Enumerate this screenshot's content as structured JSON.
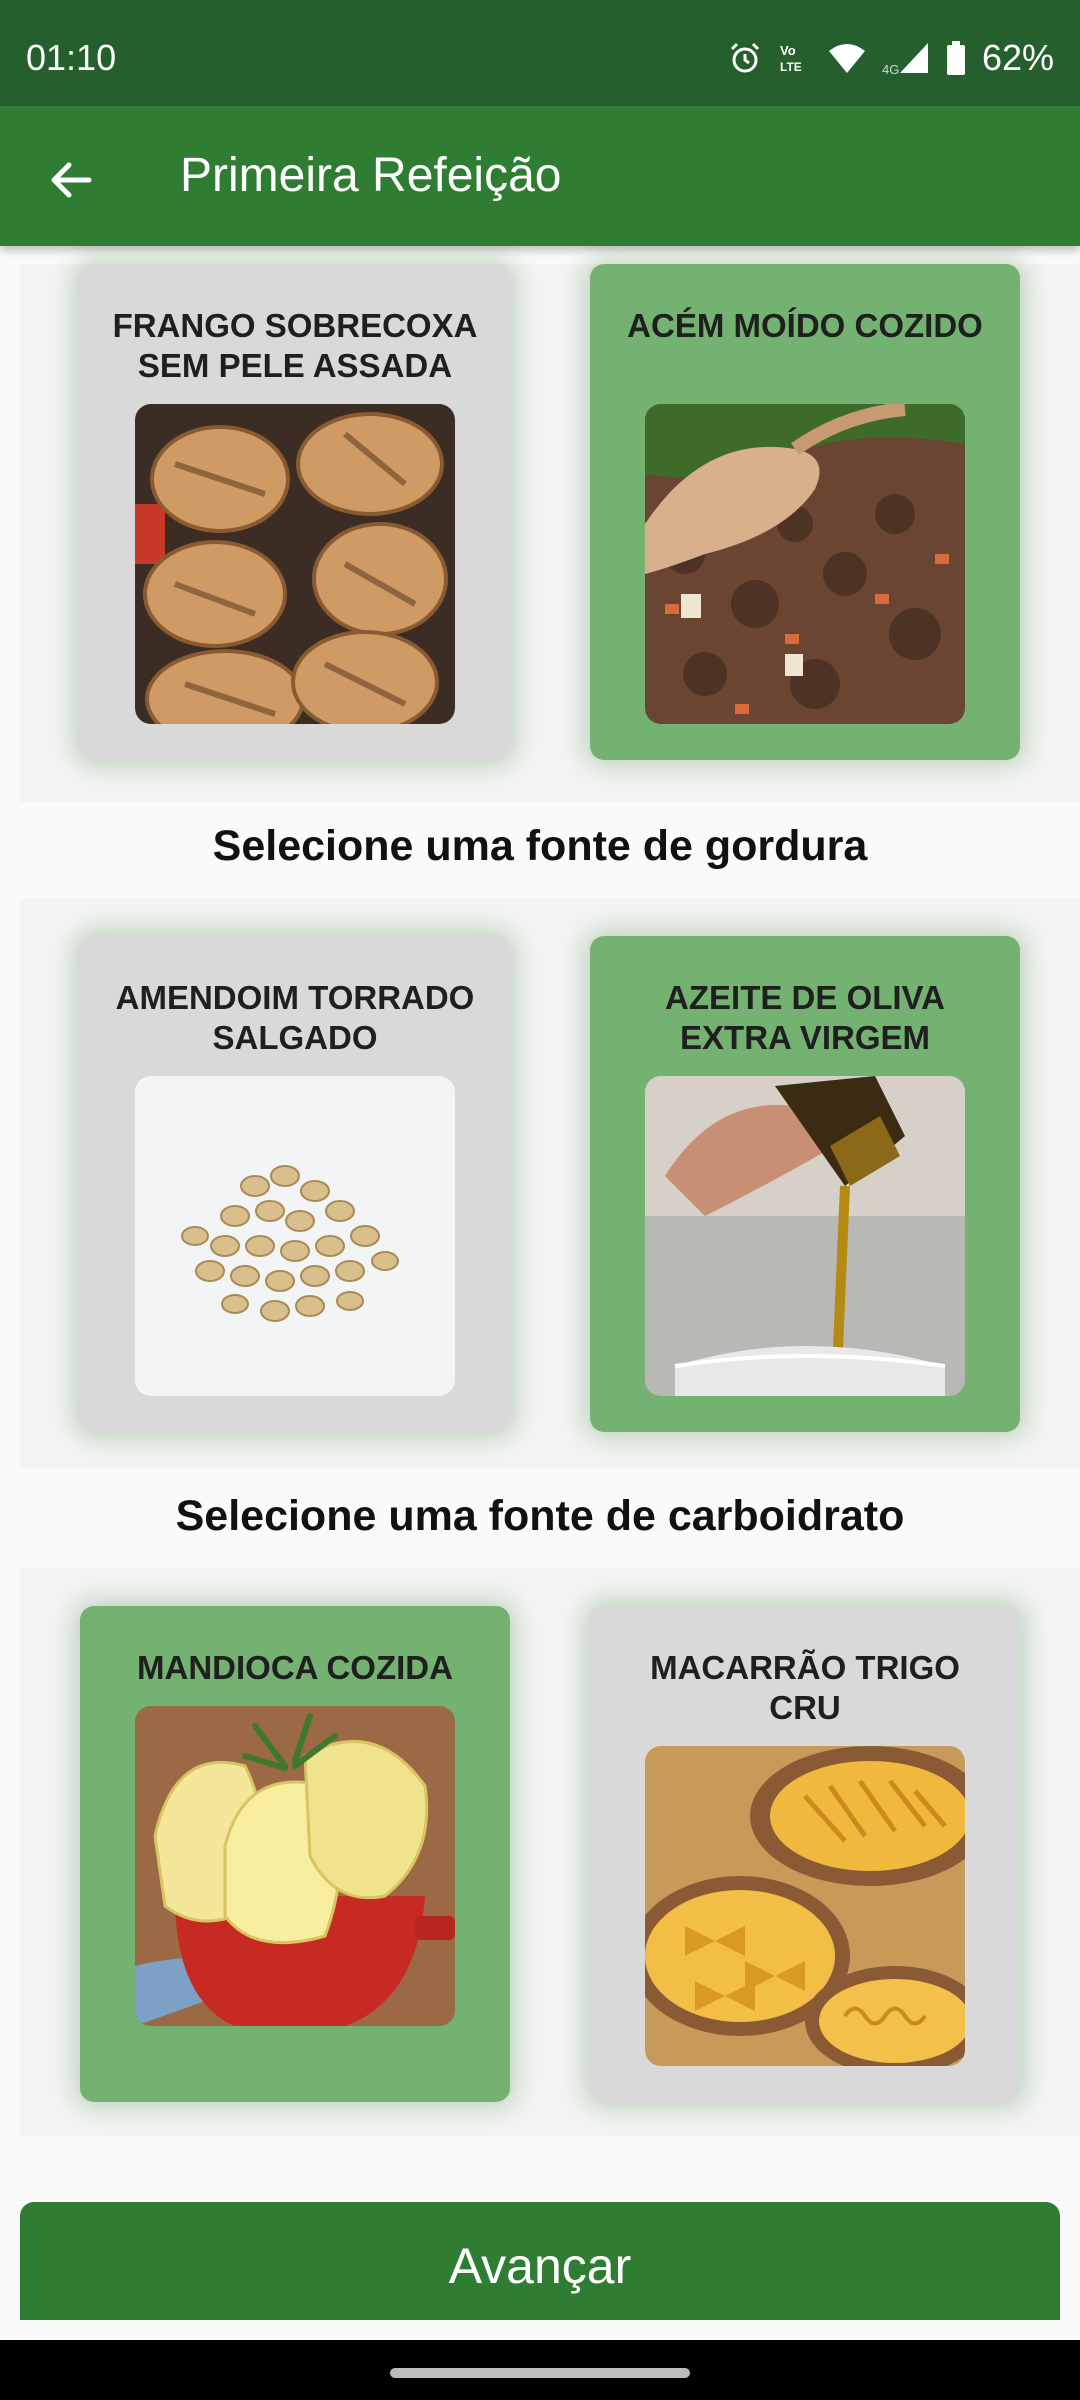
{
  "status_bar": {
    "time": "01:10",
    "battery": "62%",
    "icons": [
      "alarm-icon",
      "volte-icon",
      "wifi-icon",
      "4g-signal-icon",
      "battery-icon"
    ]
  },
  "app_bar": {
    "title": "Primeira Refeição",
    "back_icon": "arrow-left-icon"
  },
  "colors": {
    "status_bar": "#255f2d",
    "primary": "#2e7d32",
    "card_selected": "#73b271",
    "card_default": "#d9d9d9"
  },
  "sections": [
    {
      "title": "",
      "options": [
        {
          "label": "FRANGO SOBRECOXA SEM PELE ASSADA",
          "image": "grilled-chicken-thighs",
          "selected": false
        },
        {
          "label": "ACÉM MOÍDO COZIDO",
          "image": "ground-beef",
          "selected": true
        }
      ]
    },
    {
      "title": "Selecione uma fonte de gordura",
      "options": [
        {
          "label": "AMENDOIM TORRADO SALGADO",
          "image": "roasted-peanuts",
          "selected": false
        },
        {
          "label": "AZEITE DE OLIVA EXTRA VIRGEM",
          "image": "olive-oil-pour",
          "selected": true
        }
      ]
    },
    {
      "title": "Selecione uma fonte de carboidrato",
      "options": [
        {
          "label": "MANDIOCA COZIDA",
          "image": "boiled-cassava",
          "selected": true
        },
        {
          "label": "MACARRÃO TRIGO CRU",
          "image": "raw-pasta",
          "selected": false
        }
      ]
    }
  ],
  "footer": {
    "next_label": "Avançar"
  }
}
